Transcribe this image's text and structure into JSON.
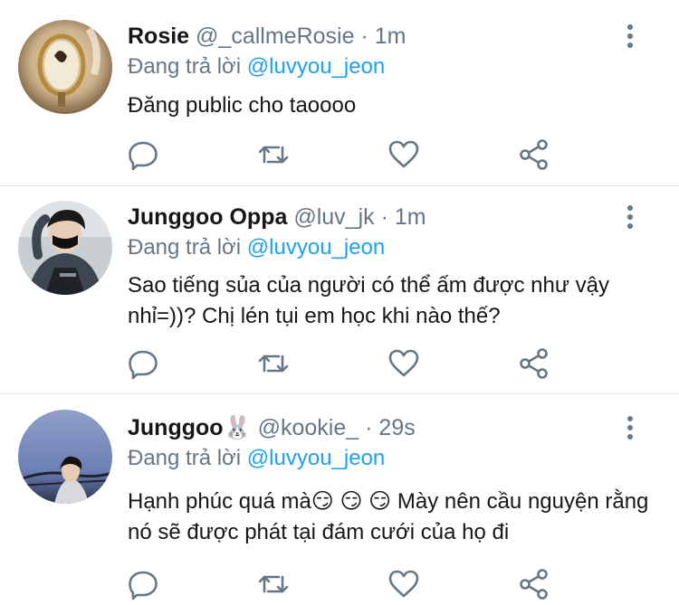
{
  "tweets": [
    {
      "display_name": "Rosie",
      "handle": "@_callmeRosie",
      "separator": "·",
      "time": "1m",
      "reply_prefix": "Đang trả lời",
      "reply_to": "@luvyou_jeon",
      "text": "Đăng public cho taoooo"
    },
    {
      "display_name": "Junggoo Oppa",
      "handle": "@luv_jk",
      "separator": "·",
      "time": "1m",
      "reply_prefix": "Đang trả lời",
      "reply_to": "@luvyou_jeon",
      "text": "Sao tiếng sủa của người có thể ấm được như vậy nhỉ=))? Chị lén tụi em học khi nào thế?"
    },
    {
      "display_name": "Junggoo🐰",
      "handle": "@kookie_",
      "separator": "·",
      "time": "29s",
      "reply_prefix": "Đang trả lời",
      "reply_to": "@luvyou_jeon",
      "text": "Hạnh phúc quá mà😏 😏 😏  Mày nên cầu nguyện rằng nó sẽ được phát tại đám cưới của họ đi"
    }
  ],
  "icons": {
    "reply": "comment-icon",
    "retweet": "retweet-icon",
    "like": "heart-icon",
    "share": "share-icon",
    "more": "more-vertical-icon"
  },
  "colors": {
    "text": "#14171a",
    "secondary": "#657786",
    "mention": "#1da1f2",
    "icon": "#657786",
    "divider": "#e1e4e8"
  }
}
